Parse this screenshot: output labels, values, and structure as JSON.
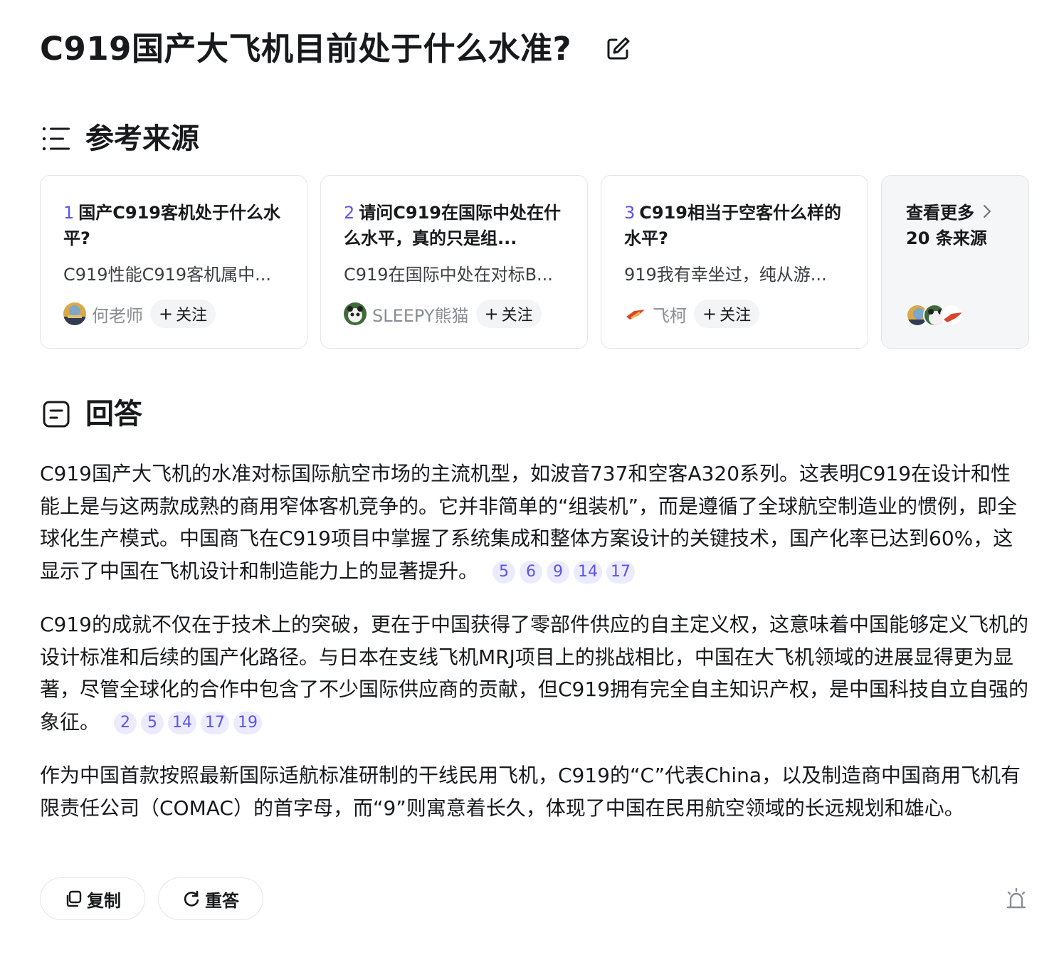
{
  "question": {
    "title": "C919国产大飞机目前处于什么水准?"
  },
  "sources": {
    "heading": "参考来源",
    "cards": [
      {
        "num": "1",
        "title": "国产C919客机处于什么水平?",
        "snippet": "C919性能C919客机属中...",
        "author": "何老师",
        "follow_label": "关注"
      },
      {
        "num": "2",
        "title": "请问C919在国际中处在什么水平，真的只是组...",
        "snippet": "C919在国际中处在对标B...",
        "author": "SLEEPY熊猫",
        "follow_label": "关注"
      },
      {
        "num": "3",
        "title": "C919相当于空客什么样的水平?",
        "snippet": "919我有幸坐过，纯从游...",
        "author": "飞柯",
        "follow_label": "关注"
      }
    ],
    "more": {
      "label": "查看更多",
      "count_text": "20 条来源"
    }
  },
  "answer": {
    "heading": "回答",
    "paragraphs": [
      {
        "text": "C919国产大飞机的水准对标国际航空市场的主流机型，如波音737和空客A320系列。这表明C919在设计和性能上是与这两款成熟的商用窄体客机竞争的。它并非简单的“组装机”，而是遵循了全球航空制造业的惯例，即全球化生产模式。中国商飞在C919项目中掌握了系统集成和整体方案设计的关键技术，国产化率已达到60%，这显示了中国在飞机设计和制造能力上的显著提升。",
        "citations": [
          "5",
          "6",
          "9",
          "14",
          "17"
        ]
      },
      {
        "text": "C919的成就不仅在于技术上的突破，更在于中国获得了零部件供应的自主定义权，这意味着中国能够定义飞机的设计标准和后续的国产化路径。与日本在支线飞机MRJ项目上的挑战相比，中国在大飞机领域的进展显得更为显著，尽管全球化的合作中包含了不少国际供应商的贡献，但C919拥有完全自主知识产权，是中国科技自立自强的象征。",
        "citations": [
          "2",
          "5",
          "14",
          "17",
          "19"
        ]
      },
      {
        "text": "作为中国首款按照最新国际适航标准研制的干线民用飞机，C919的“C”代表China，以及制造商中国商用飞机有限责任公司（COMAC）的首字母，而“9”则寓意着长久，体现了中国在民用航空领域的长远规划和雄心。",
        "citations": []
      }
    ]
  },
  "actions": {
    "copy_label": "复制",
    "regenerate_label": "重答"
  },
  "colors": {
    "accent": "#5a55e6",
    "citation_bg": "#ecebfd",
    "border": "#e4e5e8",
    "text": "#18191c",
    "muted": "#8a8d94"
  }
}
